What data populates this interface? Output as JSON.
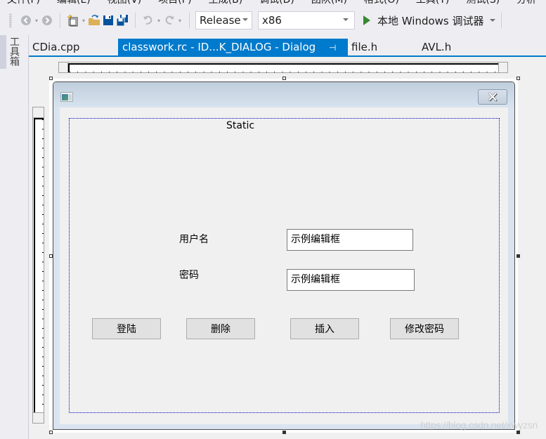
{
  "menu": [
    "文件(F)",
    "编辑(E)",
    "视图(V)",
    "项目(P)",
    "生成(B)",
    "调试(D)",
    "团队(M)",
    "格式(O)",
    "工具(T)",
    "测试(S)",
    "分析"
  ],
  "toolbar": {
    "configuration": "Release",
    "platform": "x86",
    "run_label": "本地 Windows 调试器"
  },
  "toolbox_label": "工具箱",
  "tabs": [
    {
      "label": "CDia.cpp",
      "active": false
    },
    {
      "label": "classwork.rc - ID...K_DIALOG - Dialog",
      "active": true
    },
    {
      "label": "file.h",
      "active": false
    },
    {
      "label": "AVL.h",
      "active": false
    }
  ],
  "tab_icons": {
    "pin": "⊣",
    "close": "✕"
  },
  "dialog": {
    "close_glyph": "✕",
    "static_text": "Static",
    "username_label": "用户名",
    "password_label": "密码",
    "username_edit": "示例编辑框",
    "password_edit": "示例编辑框",
    "buttons": [
      "登陆",
      "删除",
      "插入",
      "修改密码"
    ]
  },
  "watermark": "https://blog.csdn.net/xwyzsn"
}
